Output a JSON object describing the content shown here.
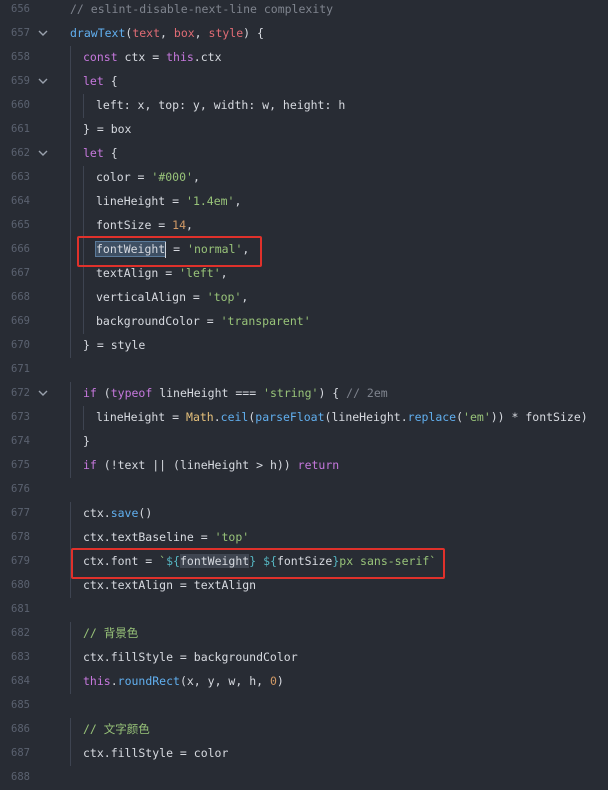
{
  "editor": {
    "lines": [
      {
        "n": "656",
        "fold": false,
        "indent": 0,
        "tokens": [
          [
            "c",
            "// eslint-disable-next-line complexity"
          ]
        ]
      },
      {
        "n": "657",
        "fold": true,
        "indent": 0,
        "tokens": [
          [
            "f",
            "drawText"
          ],
          [
            "v",
            "("
          ],
          [
            "p",
            "text"
          ],
          [
            "v",
            ", "
          ],
          [
            "p",
            "box"
          ],
          [
            "v",
            ", "
          ],
          [
            "p",
            "style"
          ],
          [
            "v",
            ") {"
          ]
        ]
      },
      {
        "n": "658",
        "fold": false,
        "indent": 1,
        "tokens": [
          [
            "k",
            "const "
          ],
          [
            "v",
            "ctx = "
          ],
          [
            "k",
            "this"
          ],
          [
            "v",
            ".ctx"
          ]
        ]
      },
      {
        "n": "659",
        "fold": true,
        "indent": 1,
        "tokens": [
          [
            "k",
            "let "
          ],
          [
            "v",
            "{"
          ]
        ]
      },
      {
        "n": "660",
        "fold": false,
        "indent": 2,
        "tokens": [
          [
            "v",
            "left: x, top: y, width: w, height: h"
          ]
        ]
      },
      {
        "n": "661",
        "fold": false,
        "indent": 1,
        "tokens": [
          [
            "v",
            "} = box"
          ]
        ]
      },
      {
        "n": "662",
        "fold": true,
        "indent": 1,
        "tokens": [
          [
            "k",
            "let "
          ],
          [
            "v",
            "{"
          ]
        ]
      },
      {
        "n": "663",
        "fold": false,
        "indent": 2,
        "tokens": [
          [
            "v",
            "color = "
          ],
          [
            "s",
            "'#000'"
          ],
          [
            "v",
            ","
          ]
        ]
      },
      {
        "n": "664",
        "fold": false,
        "indent": 2,
        "tokens": [
          [
            "v",
            "lineHeight = "
          ],
          [
            "s",
            "'1.4em'"
          ],
          [
            "v",
            ","
          ]
        ]
      },
      {
        "n": "665",
        "fold": false,
        "indent": 2,
        "tokens": [
          [
            "v",
            "fontSize = "
          ],
          [
            "n",
            "14"
          ],
          [
            "v",
            ","
          ]
        ]
      },
      {
        "n": "666",
        "fold": false,
        "indent": 2,
        "tokens": [
          [
            "sel",
            "fontWeight"
          ],
          [
            "v",
            " = "
          ],
          [
            "s",
            "'normal'"
          ],
          [
            "v",
            ","
          ]
        ]
      },
      {
        "n": "667",
        "fold": false,
        "indent": 2,
        "tokens": [
          [
            "v",
            "textAlign = "
          ],
          [
            "s",
            "'left'"
          ],
          [
            "v",
            ","
          ]
        ]
      },
      {
        "n": "668",
        "fold": false,
        "indent": 2,
        "tokens": [
          [
            "v",
            "verticalAlign = "
          ],
          [
            "s",
            "'top'"
          ],
          [
            "v",
            ","
          ]
        ]
      },
      {
        "n": "669",
        "fold": false,
        "indent": 2,
        "tokens": [
          [
            "v",
            "backgroundColor = "
          ],
          [
            "s",
            "'transparent'"
          ]
        ]
      },
      {
        "n": "670",
        "fold": false,
        "indent": 1,
        "tokens": [
          [
            "v",
            "} = style"
          ]
        ]
      },
      {
        "n": "671",
        "fold": false,
        "indent": 0,
        "tokens": []
      },
      {
        "n": "672",
        "fold": true,
        "indent": 1,
        "tokens": [
          [
            "k",
            "if "
          ],
          [
            "v",
            "("
          ],
          [
            "k",
            "typeof "
          ],
          [
            "v",
            "lineHeight === "
          ],
          [
            "s",
            "'string'"
          ],
          [
            "v",
            ") { "
          ],
          [
            "c",
            "// 2em"
          ]
        ]
      },
      {
        "n": "673",
        "fold": false,
        "indent": 2,
        "tokens": [
          [
            "v",
            "lineHeight = "
          ],
          [
            "fy",
            "Math"
          ],
          [
            "v",
            "."
          ],
          [
            "f",
            "ceil"
          ],
          [
            "v",
            "("
          ],
          [
            "f",
            "parseFloat"
          ],
          [
            "v",
            "(lineHeight."
          ],
          [
            "f",
            "replace"
          ],
          [
            "v",
            "("
          ],
          [
            "s",
            "'em'"
          ],
          [
            "v",
            ")) * fontSize)"
          ]
        ]
      },
      {
        "n": "674",
        "fold": false,
        "indent": 1,
        "tokens": [
          [
            "v",
            "}"
          ]
        ]
      },
      {
        "n": "675",
        "fold": false,
        "indent": 1,
        "tokens": [
          [
            "k",
            "if "
          ],
          [
            "v",
            "(!text || (lineHeight > h)) "
          ],
          [
            "k",
            "return"
          ]
        ]
      },
      {
        "n": "676",
        "fold": false,
        "indent": 0,
        "tokens": []
      },
      {
        "n": "677",
        "fold": false,
        "indent": 1,
        "tokens": [
          [
            "v",
            "ctx."
          ],
          [
            "f",
            "save"
          ],
          [
            "v",
            "()"
          ]
        ]
      },
      {
        "n": "678",
        "fold": false,
        "indent": 1,
        "tokens": [
          [
            "v",
            "ctx.textBaseline = "
          ],
          [
            "s",
            "'top'"
          ]
        ]
      },
      {
        "n": "679",
        "fold": false,
        "indent": 1,
        "tokens": [
          [
            "v",
            "ctx.font = "
          ],
          [
            "s",
            "`"
          ],
          [
            "o",
            "${"
          ],
          [
            "hl",
            "fontWeight"
          ],
          [
            "o",
            "}"
          ],
          [
            "s",
            " "
          ],
          [
            "o",
            "${"
          ],
          [
            "v",
            "fontSize"
          ],
          [
            "o",
            "}"
          ],
          [
            "s",
            "px sans-serif`"
          ]
        ]
      },
      {
        "n": "680",
        "fold": false,
        "indent": 1,
        "tokens": [
          [
            "v",
            "ctx.textAlign = textAlign"
          ]
        ]
      },
      {
        "n": "681",
        "fold": false,
        "indent": 0,
        "tokens": []
      },
      {
        "n": "682",
        "fold": false,
        "indent": 1,
        "tokens": [
          [
            "cc",
            "// 背景色"
          ]
        ]
      },
      {
        "n": "683",
        "fold": false,
        "indent": 1,
        "tokens": [
          [
            "v",
            "ctx.fillStyle = backgroundColor"
          ]
        ]
      },
      {
        "n": "684",
        "fold": false,
        "indent": 1,
        "tokens": [
          [
            "k",
            "this"
          ],
          [
            "v",
            "."
          ],
          [
            "f",
            "roundRect"
          ],
          [
            "v",
            "(x, y, w, h, "
          ],
          [
            "n",
            "0"
          ],
          [
            "v",
            ")"
          ]
        ]
      },
      {
        "n": "685",
        "fold": false,
        "indent": 0,
        "tokens": []
      },
      {
        "n": "686",
        "fold": false,
        "indent": 1,
        "tokens": [
          [
            "cc",
            "// 文字颜色"
          ]
        ]
      },
      {
        "n": "687",
        "fold": false,
        "indent": 1,
        "tokens": [
          [
            "v",
            "ctx.fillStyle = color"
          ]
        ]
      },
      {
        "n": "688",
        "fold": false,
        "indent": 0,
        "tokens": []
      }
    ],
    "highlights": [
      {
        "label": "fontWeight default highlight",
        "line": "666"
      },
      {
        "label": "ctx.font template highlight",
        "line": "679"
      }
    ],
    "colors": {
      "background": "#282c34",
      "highlight_box": "#e0312b",
      "line_number": "#5b6270"
    }
  }
}
